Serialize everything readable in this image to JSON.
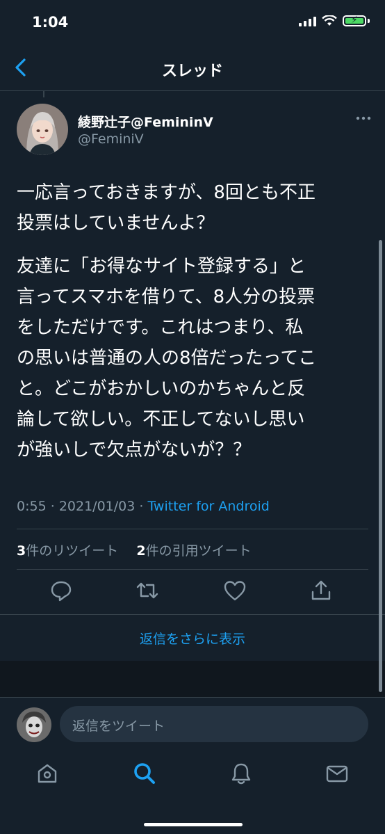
{
  "status_bar": {
    "time": "1:04"
  },
  "header": {
    "title": "スレッド"
  },
  "tweet": {
    "display_name": "綾野辻子@FemininV",
    "handle": "@FeminiV",
    "paragraph1": "一応言っておきますが、8回とも不正\n投票はしていませんよ？",
    "paragraph2": "友達に「お得なサイト登録する」と\n言ってスマホを借りて、8人分の投票\nをしただけです。これはつまり、私\nの思いは普通の人の8倍だったってこ\nと。どこがおかしいのかちゃんと反\n論して欲しい。不正してないし思い\nが強いしで欠点がないが？？",
    "time": "0:55",
    "date": "2021/01/03",
    "source": "Twitter for Android",
    "retweet_count": "3",
    "retweet_label": "件のリツイート",
    "quote_count": "2",
    "quote_label": "件の引用ツイート"
  },
  "more_replies": "返信をさらに表示",
  "reply_placeholder": "返信をツイート",
  "icons": [
    "back-icon",
    "more-icon",
    "reply-icon",
    "retweet-icon",
    "like-icon",
    "share-icon",
    "home-icon",
    "search-icon",
    "notifications-icon",
    "messages-icon"
  ],
  "colors": {
    "background": "#15202b",
    "accent": "#1da1f2",
    "secondary_text": "#8899a6",
    "divider": "#38444d"
  }
}
